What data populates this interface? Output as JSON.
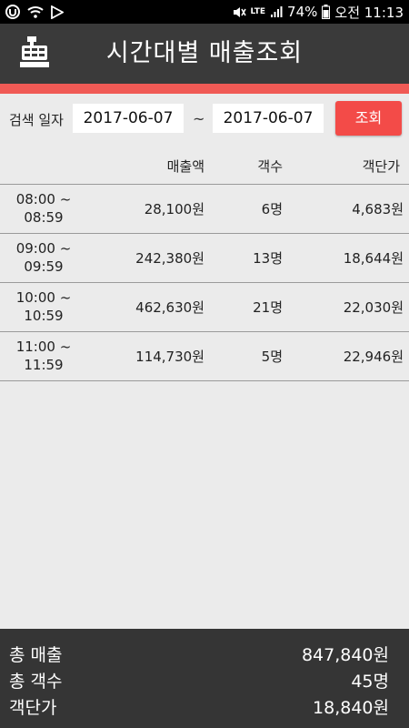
{
  "status_bar": {
    "battery": "74%",
    "network": "LTE",
    "time": "오전 11:13"
  },
  "app_bar": {
    "title": "시간대별 매출조회",
    "icon": "cash-register-icon"
  },
  "colors": {
    "accent": "#f05a55",
    "button": "#f34b48",
    "app_bar": "#3a3a3a",
    "footer": "#353535"
  },
  "search": {
    "label": "검색 일자",
    "date_from": "2017-06-07",
    "separator": "~",
    "date_to": "2017-06-07",
    "button_label": "조회"
  },
  "table": {
    "headers": [
      "매출액",
      "객수",
      "객단가"
    ],
    "rows": [
      {
        "time_start": "08:00 ~",
        "time_end": "08:59",
        "sales": "28,100원",
        "customers": "6명",
        "avg": "4,683원"
      },
      {
        "time_start": "09:00 ~",
        "time_end": "09:59",
        "sales": "242,380원",
        "customers": "13명",
        "avg": "18,644원"
      },
      {
        "time_start": "10:00 ~",
        "time_end": "10:59",
        "sales": "462,630원",
        "customers": "21명",
        "avg": "22,030원"
      },
      {
        "time_start": "11:00 ~",
        "time_end": "11:59",
        "sales": "114,730원",
        "customers": "5명",
        "avg": "22,946원"
      }
    ]
  },
  "summary": {
    "total_sales_label": "총 매출",
    "total_sales_value": "847,840원",
    "total_customers_label": "총 객수",
    "total_customers_value": "45명",
    "avg_label": "객단가",
    "avg_value": "18,840원"
  }
}
